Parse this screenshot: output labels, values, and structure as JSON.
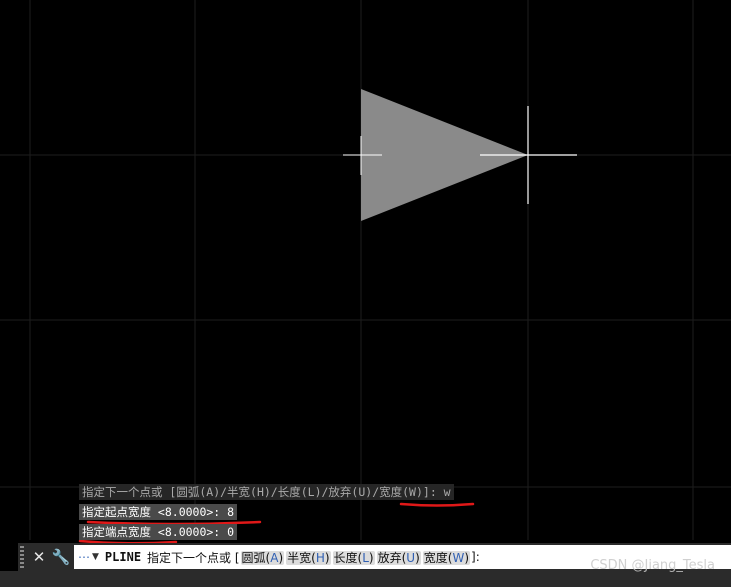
{
  "history": [
    "指定下一个点或 [圆弧(A)/半宽(H)/长度(L)/放弃(U)/宽度(W)]: w",
    "指定起点宽度 <8.0000>: 8",
    "指定端点宽度 <8.0000>: 0"
  ],
  "command": {
    "name": "PLINE",
    "prompt": "指定下一个点或 [",
    "options": [
      {
        "label": "圆弧(",
        "key": "A",
        "end": ")"
      },
      {
        "label": "半宽(",
        "key": "H",
        "end": ")"
      },
      {
        "label": "长度(",
        "key": "L",
        "end": ")"
      },
      {
        "label": "放弃(",
        "key": "U",
        "end": ")"
      },
      {
        "label": "宽度(",
        "key": "W",
        "end": ")"
      }
    ],
    "suffix": "]:"
  },
  "toolbar": {
    "close_glyph": "✕",
    "customize_glyph": "🔧",
    "recent_dots": "⋯",
    "recent_arrow": "▼"
  },
  "icons": [
    "close-icon",
    "wrench-icon",
    "recent-commands-icon",
    "chevron-down-icon"
  ],
  "watermark": "CSDN @Jiang_Tesla",
  "colors": {
    "background": "#000000",
    "grid": "#1e1e1e",
    "shape_fill": "#8a8a8a",
    "crosshair": "#ffffff",
    "annotation_underline": "#e01818",
    "option_key": "#2f5fb3"
  }
}
